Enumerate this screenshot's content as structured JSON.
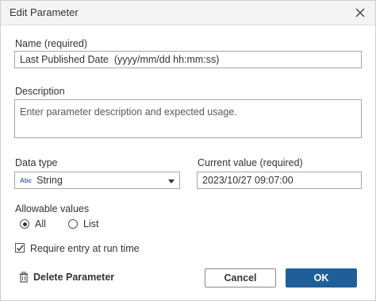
{
  "dialog": {
    "title": "Edit Parameter"
  },
  "name": {
    "label": "Name (required)",
    "value": "Last Published Date  (yyyy/mm/dd hh:mm:ss)"
  },
  "description": {
    "label": "Description",
    "placeholder": "Enter parameter description and expected usage."
  },
  "data_type": {
    "label": "Data type",
    "type_badge": "Abc",
    "selected": "String"
  },
  "current_value": {
    "label": "Current value (required)",
    "value": "2023/10/27 09:07:00"
  },
  "allowable_values": {
    "label": "Allowable values",
    "options": [
      "All",
      "List"
    ],
    "selected": "All"
  },
  "require_entry": {
    "label": "Require entry at run time",
    "checked": true
  },
  "footer": {
    "delete_label": "Delete Parameter",
    "cancel_label": "Cancel",
    "ok_label": "OK"
  },
  "colors": {
    "primary": "#1f5f99",
    "titlebar": "#f4f4f4"
  }
}
